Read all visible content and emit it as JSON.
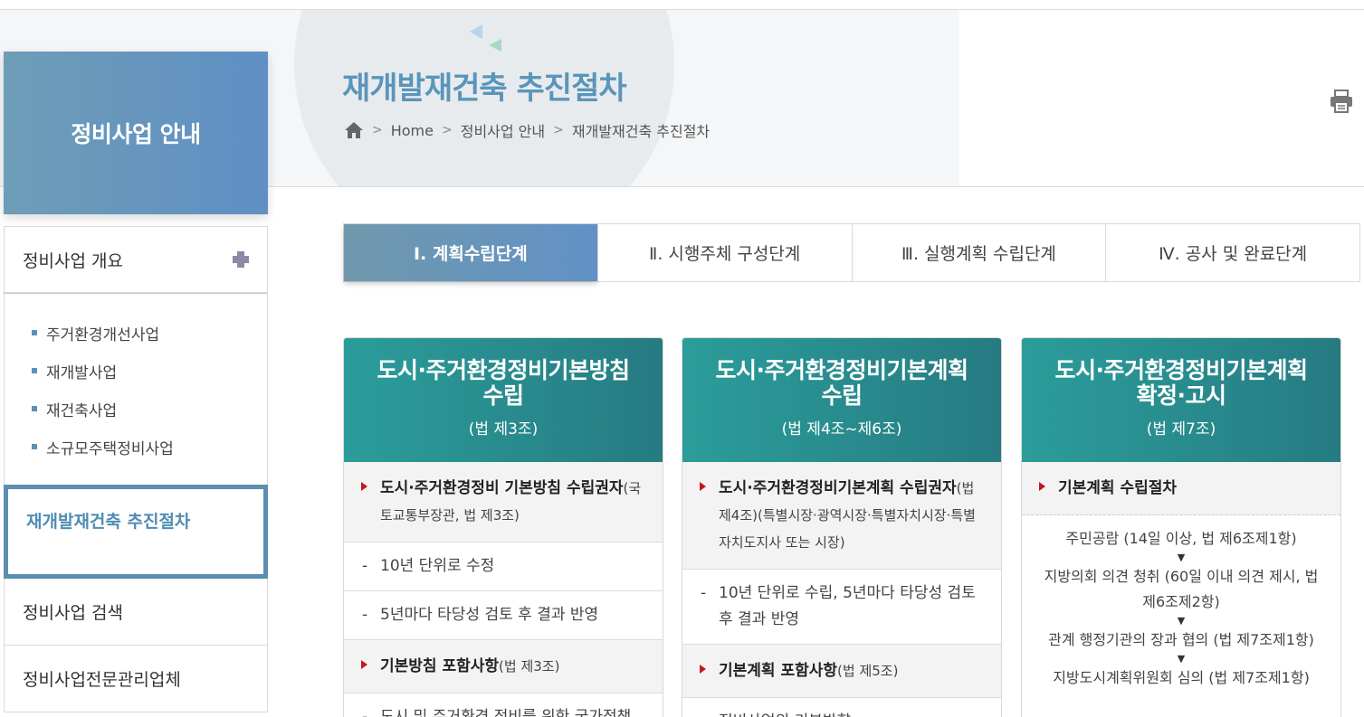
{
  "header": {
    "title": "재개발재건축 추진절차",
    "breadcrumb": [
      "Home",
      "정비사업 안내",
      "재개발재건축 추진절차"
    ]
  },
  "sidebar": {
    "hero_title": "정비사업 안내",
    "items": [
      {
        "label": "정비사업 개요"
      },
      {
        "label": "재개발재건축 추진절차"
      },
      {
        "label": "정비사업 검색"
      },
      {
        "label": "정비사업전문관리업체"
      }
    ],
    "sub_items": [
      "주거환경개선사업",
      "재개발사업",
      "재건축사업",
      "소규모주택정비사업"
    ]
  },
  "tabs": [
    {
      "label": "Ⅰ. 계획수립단계",
      "active": true
    },
    {
      "label": "Ⅱ. 시행주체 구성단계",
      "active": false
    },
    {
      "label": "Ⅲ. 실행계획 수립단계",
      "active": false
    },
    {
      "label": "Ⅳ. 공사 및 완료단계",
      "active": false
    }
  ],
  "cards": [
    {
      "title": "도시·주거환경정비기본방침 수립",
      "law": "(법 제3조)",
      "head1_bold": "도시·주거환경정비 기본방침 수립권자",
      "head1_rest": "(국토교통부장관, 법 제3조)",
      "dash1": "10년 단위로 수정",
      "dash2": "5년마다 타당성 검토 후 결과 반영",
      "head2_bold": "기본방침 포함사항",
      "head2_rest": "(법 제3조)",
      "dash3": "도시 및 주거환경 정비를 위한 국가정책"
    },
    {
      "title": "도시·주거환경정비기본계획 수립",
      "law": "(법 제4조~제6조)",
      "head1_bold": "도시·주거환경정비기본계획 수립권자",
      "head1_rest": "(법 제4조)(특별시장·광역시장·특별자치시장·특별자치도지사 또는 시장)",
      "dash1": "10년 단위로 수립, 5년마다 타당성 검토 후 결과 반영",
      "head2_bold": "기본계획 포함사항",
      "head2_rest": "(법 제5조)",
      "dash3": "정비사업의 기본방향"
    },
    {
      "title": "도시·주거환경정비기본계획 확정·고시",
      "law": "(법 제7조)",
      "head1_bold": "기본계획 수립절차",
      "steps": [
        "주민공람 (14일 이상, 법 제6조제1항)",
        "지방의회 의견 청취 (60일 이내 의견 제시, 법 제6조제2항)",
        "관계 행정기관의 장과 협의 (법 제7조제1항)",
        "지방도시계획위원회 심의 (법 제7조제1항)"
      ],
      "arrow": "▼"
    }
  ]
}
